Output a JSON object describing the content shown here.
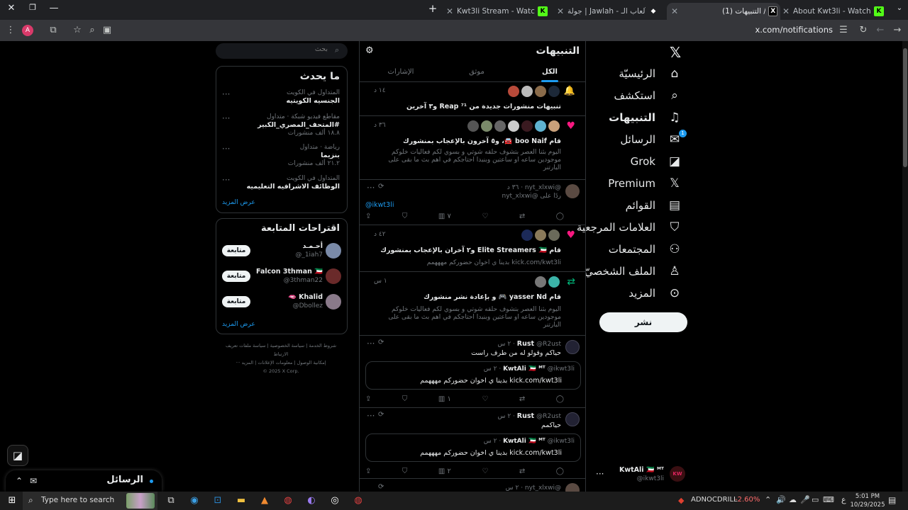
{
  "browser": {
    "tabs": [
      {
        "title": "About Kwt3li - Watch Live on K",
        "favicon": "K",
        "active": false
      },
      {
        "title": "(1) التنبيهات / X",
        "favicon": "X",
        "active": true
      },
      {
        "title": "جولة | Jawlah - منصة الألعاب الـ",
        "favicon": "◆",
        "active": false
      },
      {
        "title": "Kwt3li Stream - Watch Live on",
        "favicon": "K",
        "active": false
      }
    ],
    "url": "x.com/notifications",
    "new_tab_label": "+",
    "profile_initial": "A"
  },
  "nav": {
    "items": [
      {
        "label": "الرئيسيّة",
        "icon": "home-icon",
        "glyph": "⌂"
      },
      {
        "label": "استكشف",
        "icon": "search-icon",
        "glyph": "⌕"
      },
      {
        "label": "التنبيهات",
        "icon": "bell-icon",
        "glyph": "🔔"
      },
      {
        "label": "الرسائل",
        "icon": "mail-icon",
        "glyph": "✉"
      },
      {
        "label": "Grok",
        "icon": "grok-icon",
        "glyph": "◪"
      },
      {
        "label": "Premium",
        "icon": "x-logo-icon",
        "glyph": "𝕏"
      },
      {
        "label": "القوائم",
        "icon": "list-icon",
        "glyph": "▤"
      },
      {
        "label": "العلامات المرجعية",
        "icon": "bookmark-icon",
        "glyph": "🔖"
      },
      {
        "label": "المجتمعات",
        "icon": "communities-icon",
        "glyph": "👥"
      },
      {
        "label": "الملف الشخصيّ",
        "icon": "profile-icon",
        "glyph": "👤"
      },
      {
        "label": "المزيد",
        "icon": "more-icon",
        "glyph": "⊙"
      }
    ],
    "messages_badge": "1",
    "post_label": "نشر",
    "account": {
      "name": "KwtAli 🇰🇼 ᴹᵀ",
      "handle": "@ikwt3li"
    }
  },
  "header": {
    "title": "التنبيهات",
    "tabs": [
      "الكل",
      "موثق",
      "الإشارات"
    ]
  },
  "notifications": {
    "n1": {
      "time": "١٤ د",
      "text": "تنبيهات منشورات جديدة من Reap ⁷¹ و٣ آخرين"
    },
    "n2": {
      "time": "٣٦ د",
      "text": "قام boo Naif 🚘، و٥ آخرون بالإعجاب بمنشورك",
      "body": "اليوم بثنا العصر بتشوف حلقه شوتي و بسوي لكم فعاليات خلوكم موجودين ساعه او ساعتين وبنبدا احتاجكم في اهم بث ما بقى على البارتنر"
    },
    "n3": {
      "handle": "@nyt_xlxwi",
      "time": "٣٦ د",
      "reply_to": "ردًا على @nyt_xlxwi",
      "text": "@ikwt3li",
      "views": "٧"
    },
    "n4": {
      "time": "٤٢ د",
      "text": "قام Elite Streamers 🇰🇼 و٢ آخران بالإعجاب بمنشورك",
      "body": "kick.com/kwt3li بدينا ي اخوان حضوركم مهههمم"
    },
    "n5": {
      "time": "١ س",
      "text": "قام yasser Nd 🎮 و بإعادة نشر منشورك",
      "body": "اليوم بثنا العصر بتشوف حلقه شوتي و بسوي لكم فعاليات خلوكم موجودين ساعه او ساعتين وبنبدا احتاجكم في اهم بث ما بقى على البارتنر"
    },
    "n6": {
      "name": "Rust",
      "handle": "@R2ust · ٢ س",
      "text": "حياكم وقولو له من طرف راست",
      "quote_name": "KwtAli 🇰🇼 ᴹᵀ",
      "quote_handle": "@ikwt3li · ٢ س",
      "quote_text": "kick.com/kwt3li بدينا ي اخوان حضوركم مهههمم",
      "views": "١"
    },
    "n7": {
      "name": "Rust",
      "handle": "@R2ust · ٢ س",
      "text": "حياكمم",
      "quote_name": "KwtAli 🇰🇼 ᴹᵀ",
      "quote_handle": "@ikwt3li · ٢ س",
      "quote_text": "kick.com/kwt3li بدينا ي اخوان حضوركم مهههمم",
      "views": "٢"
    },
    "n8": {
      "handle": "@nyt_xlxwi · ٢ س"
    }
  },
  "search": {
    "placeholder": "بحث"
  },
  "trends": {
    "title": "ما يحدث",
    "items": [
      {
        "context": "المتداول في الكويت",
        "name": "الجنسيه الكويتيه",
        "count": ""
      },
      {
        "context": "مقاطع فيديو شبكة · متداول",
        "name": "#المتحف_المصري_الكبير",
        "count": "١٨.٨ ألف منشورات"
      },
      {
        "context": "رياضة · متداول",
        "name": "بنزيما",
        "count": "٢١.٢ ألف منشورات"
      },
      {
        "context": "المتداول في الكويت",
        "name": "الوظائف الاشرافيه التعليميه",
        "count": ""
      }
    ],
    "show_more": "عرض المزيد"
  },
  "follow": {
    "title": "اقتراحات المتابعة",
    "users": [
      {
        "name": "أحـمـد",
        "handle": "@_1iah7"
      },
      {
        "name": "Falcon 3thman 🇰🇼",
        "handle": "@3thman22"
      },
      {
        "name": "Khalid 🫦",
        "handle": "@Dbollez"
      }
    ],
    "button_label": "متابعة",
    "show_more": "عرض المزيد"
  },
  "footer": {
    "line1": "شروط الخدمة | سياسة الخصوصية | سياسة ملفات تعريف الارتباط",
    "line2": "إمكانية الوصول | معلومات الإعلانات | المزيد ···",
    "line3": "© 2025 X Corp."
  },
  "messages_drawer": {
    "label": "الرسائل"
  },
  "taskbar": {
    "search_placeholder": "Type here to search",
    "stock_name": "ADNOCDRILL",
    "stock_change": "-2.60%",
    "time": "5:01 PM",
    "date": "10/29/2025",
    "lang": "ع"
  },
  "colors": {
    "accent": "#1d9bf0",
    "like": "#f91880",
    "retweet": "#00ba7c",
    "border": "#2f3336"
  }
}
